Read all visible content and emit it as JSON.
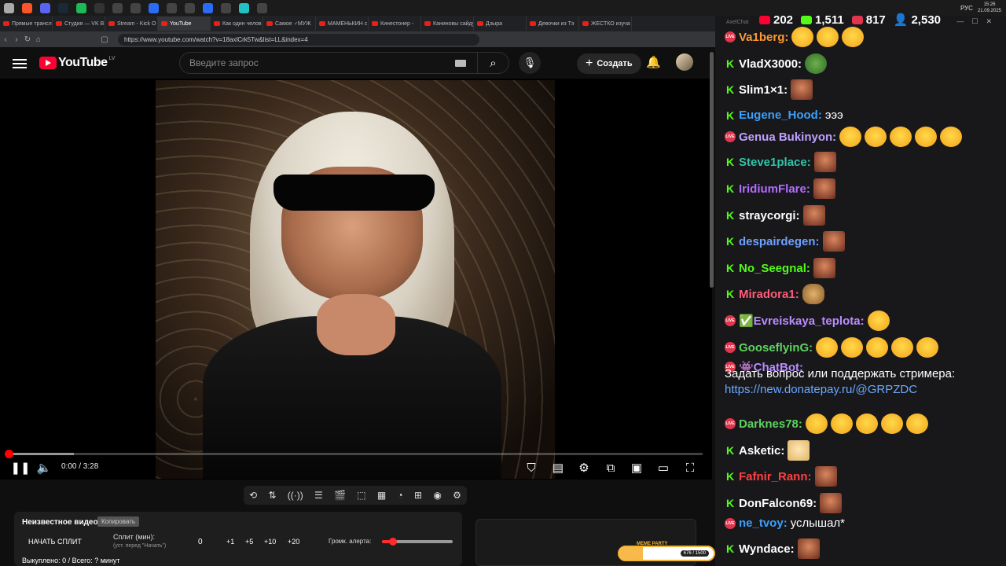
{
  "browser": {
    "tabs": [
      {
        "label": "Прямые трансл"
      },
      {
        "label": "Студия — VK В"
      },
      {
        "label": "Stream - Kick O"
      },
      {
        "label": "YouTube",
        "active": true
      },
      {
        "label": "Как один челов"
      },
      {
        "label": "Самое ♂МУЖ"
      },
      {
        "label": "МАМЕНЬКИН с"
      },
      {
        "label": "Кинестонер - "
      },
      {
        "label": "Каниновы сайду"
      },
      {
        "label": "Дзыра"
      },
      {
        "label": "Девочки из Тэ"
      },
      {
        "label": "ЖЕСТКО изуча"
      }
    ],
    "url": "https://www.youtube.com/watch?v=18axlCrk5Tw&list=LL&index=4"
  },
  "taskbar": {
    "lang": "РУС",
    "time": "15:26",
    "date": "21.09.2025"
  },
  "youtube": {
    "logo": "YouTube",
    "region": "LV",
    "search_placeholder": "Введите запрос",
    "create_label": "Создать",
    "player": {
      "current_time": "0:00",
      "duration": "3:28",
      "time_display": "0:00 / 3:28",
      "progress": 0.0,
      "buffered": 0.095
    }
  },
  "split_panel": {
    "title": "Неизвестное видео",
    "copy_label": "Копировать",
    "start_label": "НАЧАТЬ СПЛИТ",
    "split_label": "Сплит (мин):",
    "split_hint": "(уст. перед \"Начать\")",
    "split_value": "0",
    "increments": [
      "+1",
      "+5",
      "+10",
      "+20"
    ],
    "alert_volume_label": "Громк. алерта:",
    "alert_volume": 0.15,
    "bought_label": "Выкуплено: 0 / Всего: ? минут"
  },
  "meme_bar": {
    "label": "MEME PARTY",
    "count": "676 / 1500"
  },
  "chat": {
    "app_name": "AxelChat",
    "stats": {
      "youtube": "202",
      "kick": "1,511",
      "vk": "817",
      "total": "2,530"
    },
    "messages": [
      {
        "platform": "vk",
        "user": "Va1berg:",
        "color": "#ff9933",
        "emotes": [
          "laugh",
          "laugh",
          "laugh"
        ]
      },
      {
        "platform": "kick",
        "user": "VladX3000:",
        "color": "#ffffff",
        "emotes": [
          "frog"
        ]
      },
      {
        "platform": "kick",
        "user": "Slim1×1:",
        "color": "#ffffff",
        "emotes": [
          "face"
        ]
      },
      {
        "platform": "kick",
        "user": "Eugene_Hood:",
        "color": "#3aa0ff",
        "text": "эээ"
      },
      {
        "platform": "vk",
        "user": "Genua Bukinyon:",
        "color": "#c0a0ff",
        "emotes": [
          "laugh",
          "laugh",
          "laugh",
          "laugh",
          "laugh"
        ]
      },
      {
        "platform": "kick",
        "user": "Steve1place:",
        "color": "#31c4a8",
        "emotes": [
          "face"
        ]
      },
      {
        "platform": "kick",
        "user": "IridiumFlare:",
        "color": "#b46cff",
        "emotes": [
          "face"
        ]
      },
      {
        "platform": "kick",
        "user": "straycorgi:",
        "color": "#ffffff",
        "emotes": [
          "face"
        ]
      },
      {
        "platform": "kick",
        "user": "despairdegen:",
        "color": "#6fa0ff",
        "emotes": [
          "face"
        ]
      },
      {
        "platform": "kick",
        "user": "No_Seegnal:",
        "color": "#53fc18",
        "emotes": [
          "face"
        ]
      },
      {
        "platform": "kick",
        "user": "Miradora1:",
        "color": "#ff5b7a",
        "emotes": [
          "burger"
        ]
      },
      {
        "platform": "vk",
        "user": "✅Evreiskaya_teplota:",
        "color": "#b88cff",
        "emotes": [
          "laugh"
        ]
      },
      {
        "platform": "vk",
        "user": "GooseflyinG:",
        "color": "#5fd35f",
        "emotes": [
          "laugh",
          "laugh",
          "laugh",
          "laugh",
          "laugh"
        ]
      },
      {
        "platform": "vk",
        "user": "👾ChatBot:",
        "color": "#b88cff"
      },
      {
        "platform": "vk",
        "user": "Darknes78:",
        "color": "#5fd35f",
        "emotes": [
          "laugh",
          "laugh",
          "laugh",
          "laugh",
          "laugh"
        ]
      },
      {
        "platform": "kick",
        "user": "Asketic:",
        "color": "#ffffff",
        "emotes": [
          "sleep"
        ]
      },
      {
        "platform": "kick",
        "user": "Fafnir_Rann:",
        "color": "#ff4040",
        "emotes": [
          "face"
        ]
      },
      {
        "platform": "kick",
        "user": "DonFalcon69:",
        "color": "#ffffff",
        "emotes": [
          "face"
        ]
      },
      {
        "platform": "vk",
        "user": "ne_tvoy:",
        "color": "#3aa0ff",
        "text": "услышал*"
      },
      {
        "platform": "kick",
        "user": "Wyndace:",
        "color": "#ffffff",
        "emotes": [
          "face"
        ]
      }
    ],
    "chatbot_text": "Задать вопрос или поддержать стримера:",
    "chatbot_link": "https://new.donatepay.ru/@GRPZDC"
  }
}
